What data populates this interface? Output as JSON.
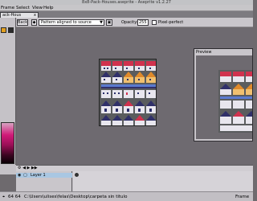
{
  "window": {
    "title": "8x8-Pack-Houses.aseprite - Aseprite v1.2.27"
  },
  "menu": {
    "items": [
      "Frame",
      "Select",
      "View",
      "Help"
    ]
  },
  "tabs": [
    {
      "label": "ack-Hous",
      "close": "x"
    }
  ],
  "toolbar": {
    "back_label": "Back",
    "pattern_value": "Pattern aligned to source",
    "opacity_label": "Opacity:",
    "opacity_value": "255",
    "pixel_perfect_label": "Pixel-perfect"
  },
  "preview": {
    "title": "Preview"
  },
  "timeline": {
    "layer_name": "Layer 1"
  },
  "status": {
    "coords": "64 64",
    "path": "C:\\Users\\ulises\\felas\\Desktop\\carpeta sin titulo",
    "frame_label": "Frame"
  },
  "colors": {
    "roof_red": "#d0324e",
    "roof_orange": "#e08a2a",
    "roof_navy": "#30306a",
    "water_blue": "#5a7ad0",
    "wall_light": "#e8e6ee"
  }
}
